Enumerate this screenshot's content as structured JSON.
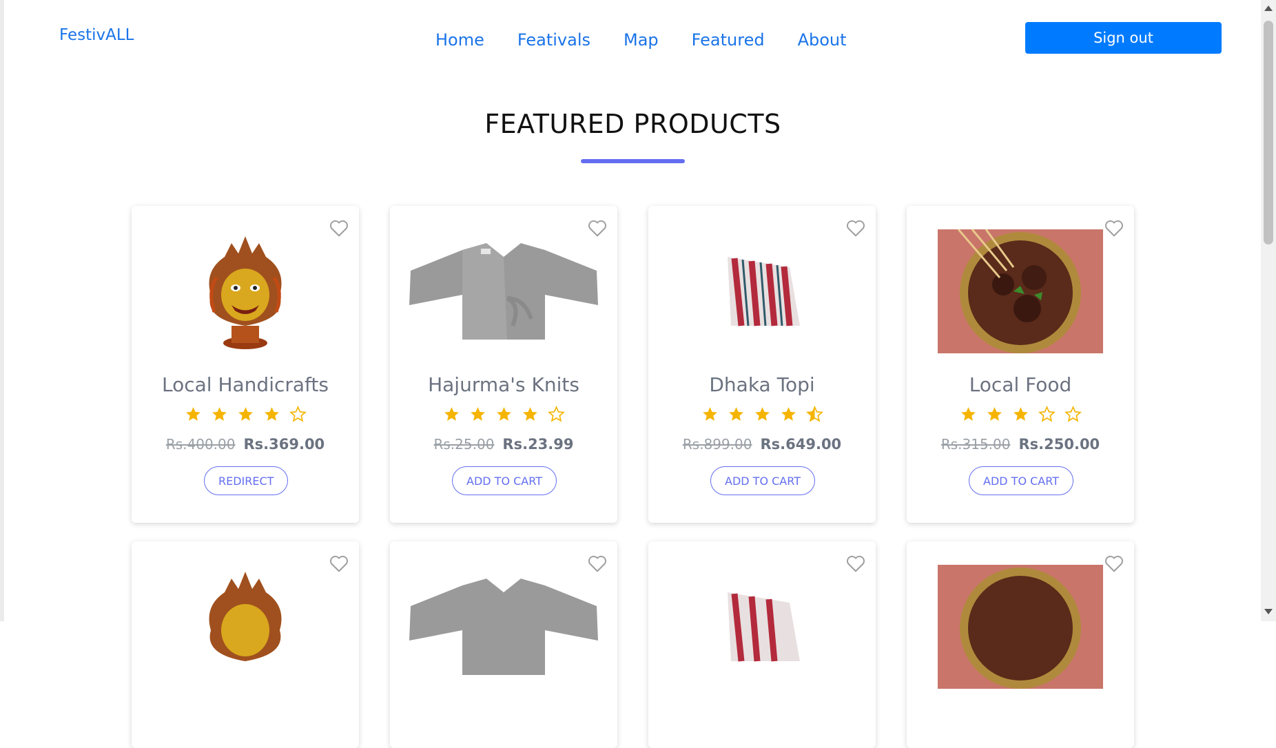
{
  "navbar": {
    "brand": "FestivALL",
    "links": [
      "Home",
      "Feativals",
      "Map",
      "Featured",
      "About"
    ],
    "signout_label": "Sign out"
  },
  "section": {
    "title": "FEATURED PRODUCTS"
  },
  "products": [
    {
      "name": "Local Handicrafts",
      "rating": 4,
      "old_price": "Rs.400.00",
      "new_price": "Rs.369.00",
      "button": "REDIRECT",
      "image_icon": "handicraft-mask-icon"
    },
    {
      "name": "Hajurma's Knits",
      "rating": 4,
      "old_price": "Rs.25.00",
      "new_price": "Rs.23.99",
      "button": "ADD TO CART",
      "image_icon": "knit-sweater-icon"
    },
    {
      "name": "Dhaka Topi",
      "rating": 4.5,
      "old_price": "Rs.899.00",
      "new_price": "Rs.649.00",
      "button": "ADD TO CART",
      "image_icon": "topi-hat-icon"
    },
    {
      "name": "Local Food",
      "rating": 3,
      "old_price": "Rs.315.00",
      "new_price": "Rs.250.00",
      "button": "ADD TO CART",
      "image_icon": "food-bowl-icon"
    }
  ],
  "colors": {
    "brand": "#1a73e8",
    "signout_bg": "#007bff",
    "accent": "#636ef0",
    "star": "#f5b400"
  }
}
